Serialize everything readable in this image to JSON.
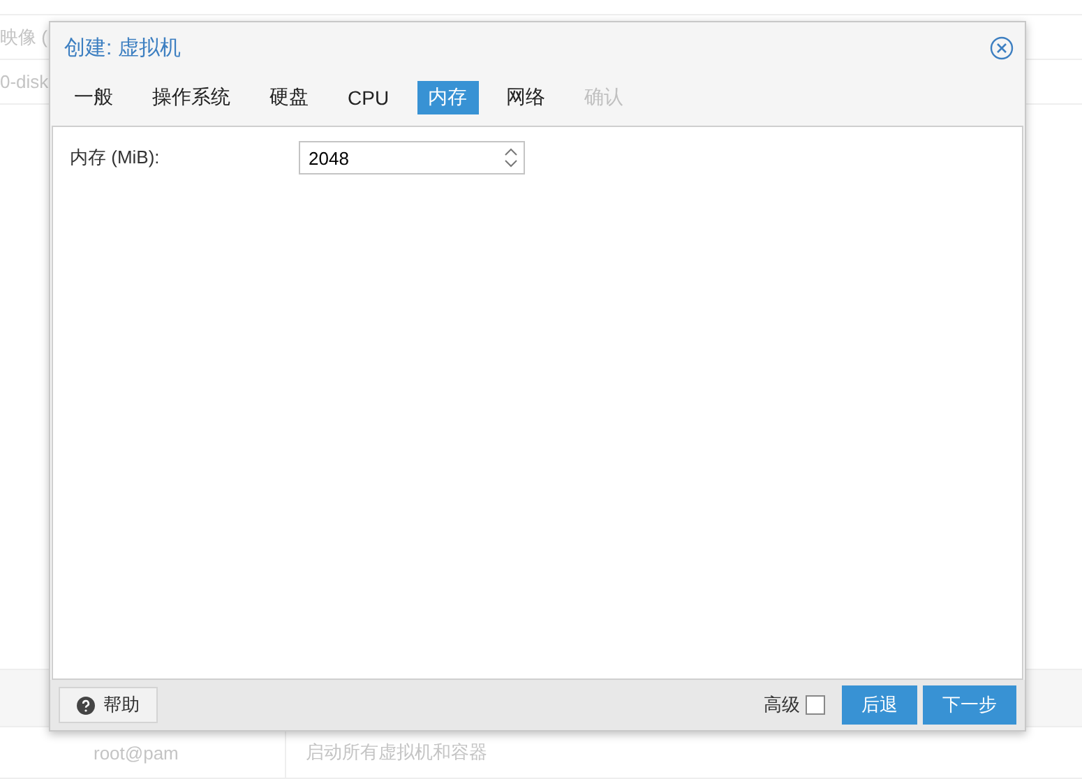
{
  "background": {
    "top_rows": [
      "映像 (",
      "0-disk"
    ],
    "table_rows": [
      {
        "cells": [
          "root@pam",
          "启动所有虚拟机和容器"
        ]
      }
    ]
  },
  "dialog": {
    "title": "创建: 虚拟机",
    "tabs": [
      {
        "label": "一般",
        "selected": false,
        "disabled": false
      },
      {
        "label": "操作系统",
        "selected": false,
        "disabled": false
      },
      {
        "label": "硬盘",
        "selected": false,
        "disabled": false
      },
      {
        "label": "CPU",
        "selected": false,
        "disabled": false
      },
      {
        "label": "内存",
        "selected": true,
        "disabled": false
      },
      {
        "label": "网络",
        "selected": false,
        "disabled": false
      },
      {
        "label": "确认",
        "selected": false,
        "disabled": true
      }
    ],
    "fields": [
      {
        "label": "内存 (MiB):",
        "value": "2048"
      }
    ],
    "help_button": "帮助",
    "advanced": {
      "label": "高级",
      "checked": false
    },
    "buttons": [
      "后退",
      "下一步"
    ]
  }
}
